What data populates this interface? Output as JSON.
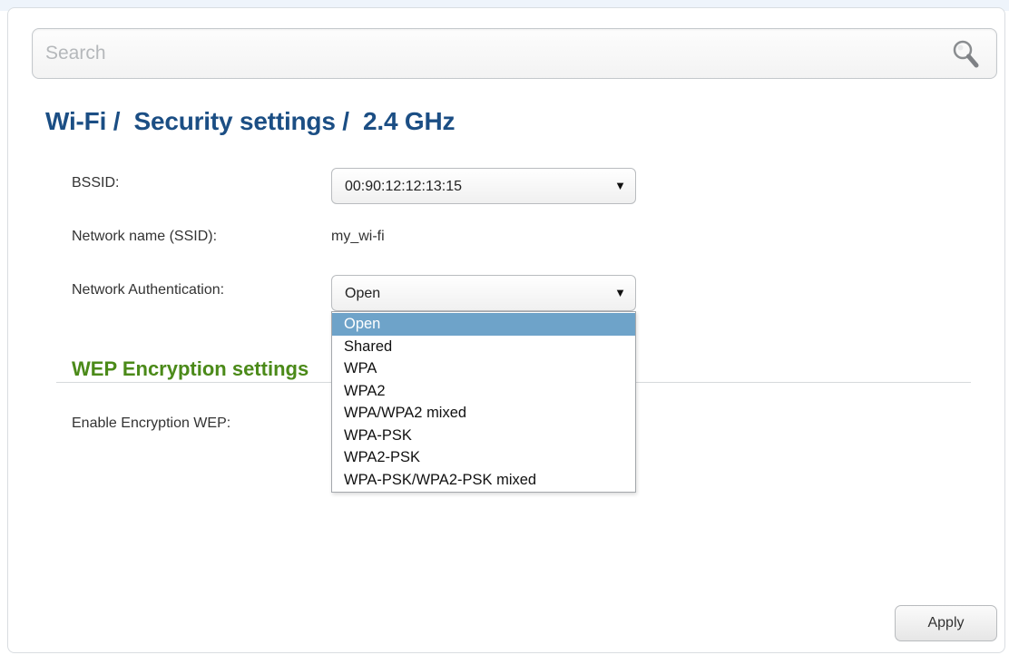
{
  "search": {
    "placeholder": "Search",
    "value": ""
  },
  "breadcrumb": {
    "title": "Wi-Fi /  Security settings /  2.4 GHz"
  },
  "form": {
    "bssid": {
      "label": "BSSID:",
      "selected": "00:90:12:12:13:15"
    },
    "ssid": {
      "label": "Network name (SSID):",
      "value": "my_wi-fi"
    },
    "auth": {
      "label": "Network Authentication:",
      "selected": "Open",
      "options": [
        "Open",
        "Shared",
        "WPA",
        "WPA2",
        "WPA/WPA2 mixed",
        "WPA-PSK",
        "WPA2-PSK",
        "WPA-PSK/WPA2-PSK mixed"
      ]
    }
  },
  "wep": {
    "section_title": "WEP Encryption settings",
    "enable_label": "Enable Encryption WEP:"
  },
  "footer": {
    "apply_label": "Apply"
  },
  "icons": {
    "search": "search-icon",
    "dropdown_arrow": "triangle-down-icon"
  },
  "colors": {
    "title": "#1b4e84",
    "section_title": "#4b8a19",
    "selected_option": "#6ea3c9"
  }
}
